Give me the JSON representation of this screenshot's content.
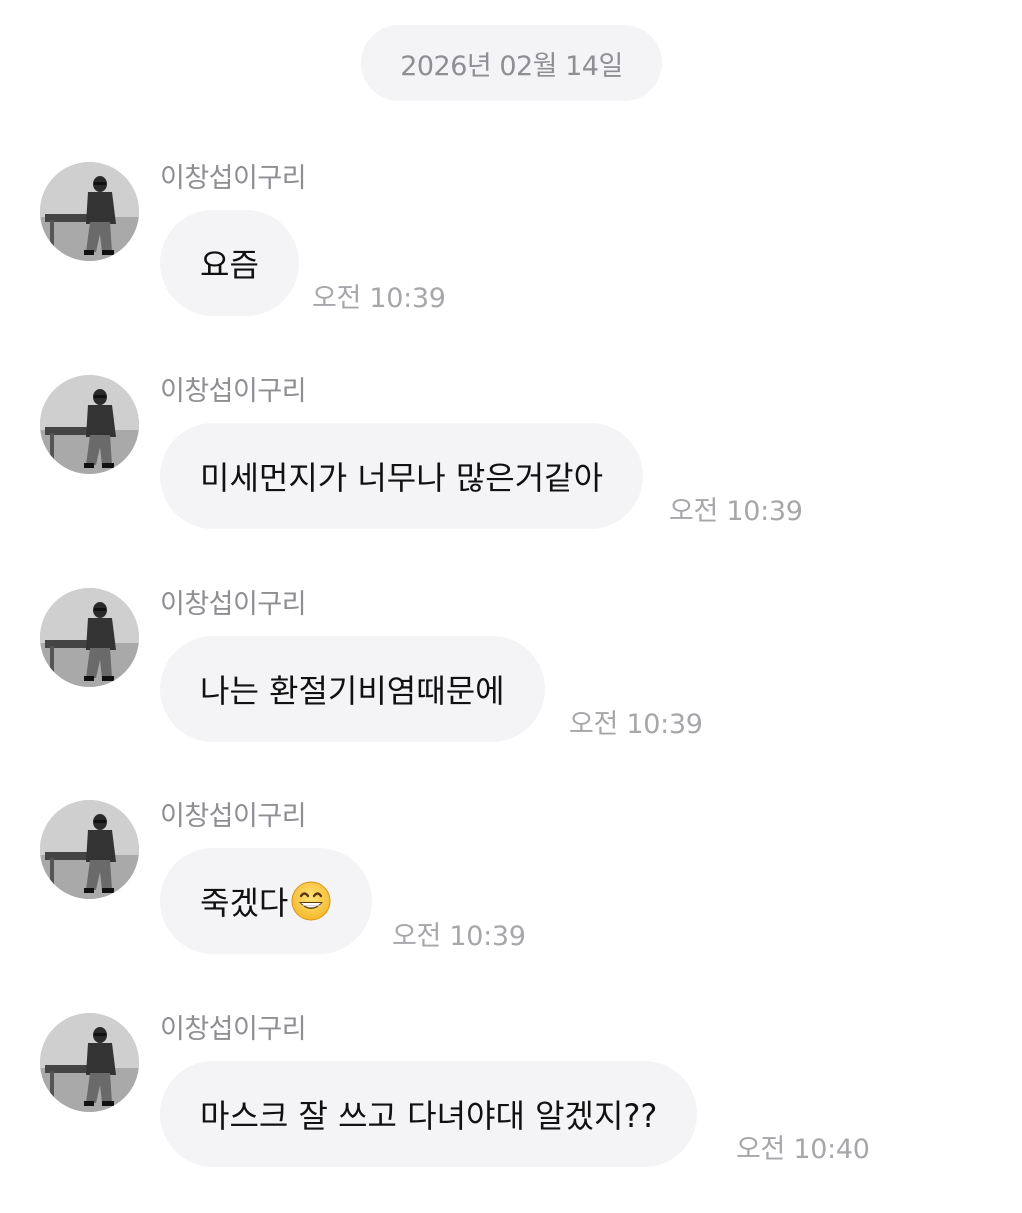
{
  "chat": {
    "date_label": "2026년 02월 14일",
    "messages": [
      {
        "sender": "이창섭이구리",
        "text": "요즘",
        "time": "오전 10:39"
      },
      {
        "sender": "이창섭이구리",
        "text": "미세먼지가 너무나 많은거같아",
        "time": "오전 10:39"
      },
      {
        "sender": "이창섭이구리",
        "text": "나는 환절기비염때문에",
        "time": "오전 10:39"
      },
      {
        "sender": "이창섭이구리",
        "text": "죽겠다",
        "emoji": "grinning-face-with-smiling-eyes-icon",
        "time": "오전 10:39"
      },
      {
        "sender": "이창섭이구리",
        "text": "마스크 잘 쓰고 다녀야대 알겠지??",
        "time": "오전 10:40"
      }
    ]
  },
  "colors": {
    "bubble_bg": "#f4f4f6",
    "meta_text": "#8e8e93",
    "time_text": "#a7a7ab",
    "message_text": "#111111"
  }
}
